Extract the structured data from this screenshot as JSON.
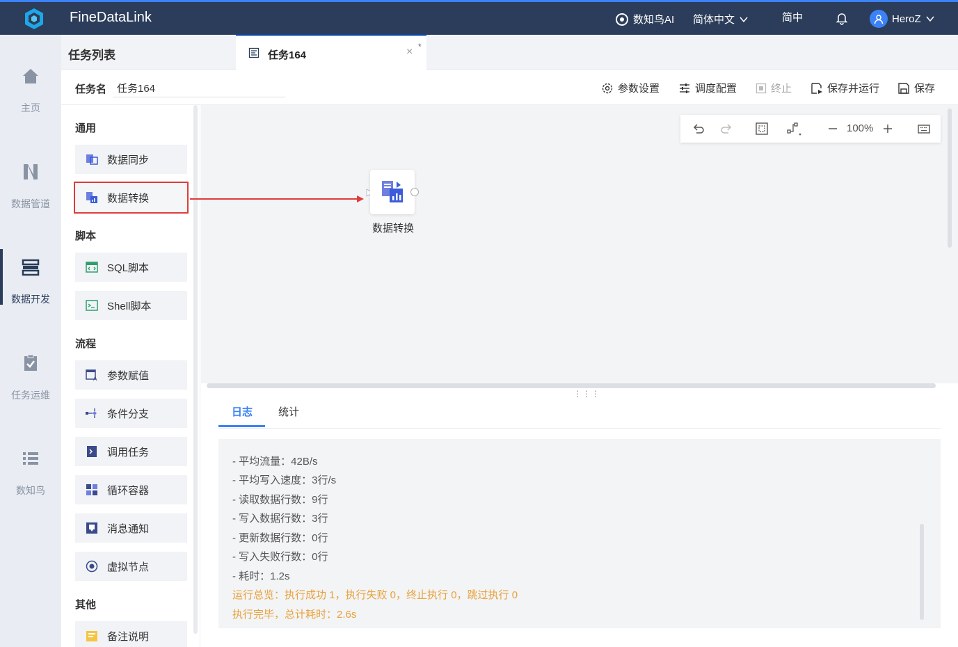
{
  "header": {
    "brand": "FineDataLink",
    "ai_label": "数知鸟AI",
    "language": "简体中文",
    "script_toggle": "简中",
    "user": "HeroZ"
  },
  "nav": {
    "items": [
      {
        "label": "主页",
        "icon": "home-icon"
      },
      {
        "label": "数据管道",
        "icon": "pipeline-icon"
      },
      {
        "label": "数据开发",
        "icon": "dev-icon",
        "active": true
      },
      {
        "label": "任务运维",
        "icon": "ops-icon"
      },
      {
        "label": "数知鸟",
        "icon": "list-icon"
      }
    ]
  },
  "tabs": {
    "panel_title": "任务列表",
    "doc_tab": "任务164",
    "close": "×",
    "modified": "*"
  },
  "task": {
    "name_label": "任务名",
    "name_value": "任务164"
  },
  "toolbar": {
    "params": "参数设置",
    "schedule": "调度配置",
    "stop": "终止",
    "save_run": "保存并运行",
    "save": "保存"
  },
  "palette": {
    "group_general": "通用",
    "data_sync": "数据同步",
    "data_transform": "数据转换",
    "group_script": "脚本",
    "sql_script": "SQL脚本",
    "shell_script": "Shell脚本",
    "group_flow": "流程",
    "param_assign": "参数赋值",
    "condition_branch": "条件分支",
    "call_task": "调用任务",
    "loop_container": "循环容器",
    "message_notify": "消息通知",
    "virtual_node": "虚拟节点",
    "group_other": "其他",
    "remark": "备注说明"
  },
  "canvas": {
    "zoom": "100%",
    "node_label": "数据转换"
  },
  "log": {
    "tab_log": "日志",
    "tab_stats": "统计",
    "lines": [
      "- 平均流量：42B/s",
      "- 平均写入速度：3行/s",
      "- 读取数据行数：9行",
      "- 写入数据行数：3行",
      "- 更新数据行数：0行",
      "- 写入失败行数：0行",
      "- 耗时：1.2s"
    ],
    "summary": "运行总览：执行成功 1，执行失败 0，终止执行 0，跳过执行 0",
    "finish": "执行完毕，总计耗时：2.6s"
  }
}
